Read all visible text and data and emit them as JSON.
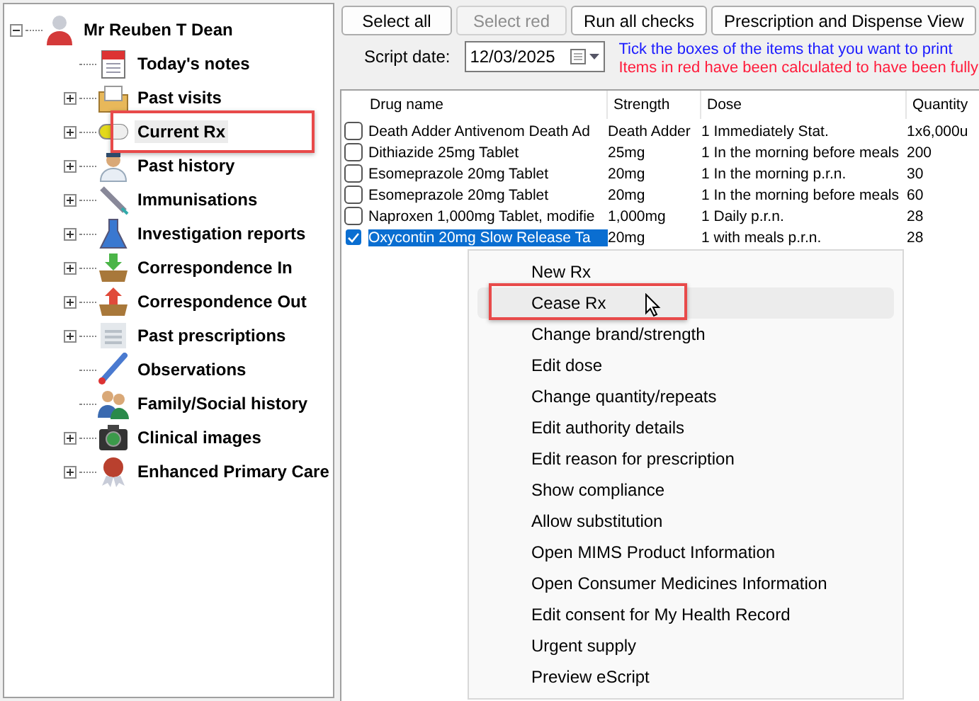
{
  "tree": {
    "label": "Mr Reuben T Dean",
    "expandable": true,
    "expanded": true,
    "children": [
      {
        "label": "Today's notes",
        "expandable": false,
        "selected": false,
        "highlighted": false
      },
      {
        "label": "Past visits",
        "expandable": true,
        "expanded": false,
        "selected": false,
        "highlighted": false
      },
      {
        "label": "Current Rx",
        "expandable": true,
        "expanded": false,
        "selected": true,
        "highlighted": true
      },
      {
        "label": "Past history",
        "expandable": true,
        "expanded": false,
        "selected": false,
        "highlighted": false
      },
      {
        "label": "Immunisations",
        "expandable": true,
        "expanded": false,
        "selected": false,
        "highlighted": false
      },
      {
        "label": "Investigation reports",
        "expandable": true,
        "expanded": false,
        "selected": false,
        "highlighted": false
      },
      {
        "label": "Correspondence In",
        "expandable": true,
        "expanded": false,
        "selected": false,
        "highlighted": false
      },
      {
        "label": "Correspondence Out",
        "expandable": true,
        "expanded": false,
        "selected": false,
        "highlighted": false
      },
      {
        "label": "Past prescriptions",
        "expandable": true,
        "expanded": false,
        "selected": false,
        "highlighted": false
      },
      {
        "label": "Observations",
        "expandable": false,
        "selected": false,
        "highlighted": false
      },
      {
        "label": "Family/Social history",
        "expandable": false,
        "selected": false,
        "highlighted": false
      },
      {
        "label": "Clinical images",
        "expandable": true,
        "expanded": false,
        "selected": false,
        "highlighted": false
      },
      {
        "label": "Enhanced Primary Care",
        "expandable": true,
        "expanded": false,
        "selected": false,
        "highlighted": false
      }
    ]
  },
  "toolbar": [
    {
      "label": "Select all",
      "disabled": false
    },
    {
      "label": "Select red",
      "disabled": true
    },
    {
      "label": "Run all checks",
      "disabled": false
    },
    {
      "label": "Prescription and Dispense View",
      "disabled": false
    }
  ],
  "script_date": {
    "label": "Script date:",
    "value": "12/03/2025"
  },
  "notices": [
    {
      "text": "Tick the boxes of the items that you want to print",
      "color": "#1a1aff"
    },
    {
      "text": "Items in red have been calculated to have been fully",
      "color": "#ff1a3a"
    }
  ],
  "table": {
    "columns": [
      "Drug name",
      "Strength",
      "Dose",
      "Quantity"
    ],
    "rows": [
      {
        "cells": [
          "Death Adder Antivenom Death Ad",
          "Death Adder",
          "1 Immediately Stat.",
          "1x6,000u"
        ],
        "checked": false,
        "selected": false
      },
      {
        "cells": [
          "Dithiazide 25mg Tablet",
          "25mg",
          "1 In the morning before meals",
          "200"
        ],
        "checked": false,
        "selected": false
      },
      {
        "cells": [
          "Esomeprazole 20mg Tablet",
          "20mg",
          "1 In the morning p.r.n.",
          "30"
        ],
        "checked": false,
        "selected": false
      },
      {
        "cells": [
          "Esomeprazole 20mg Tablet",
          "20mg",
          "1 In the morning before meals",
          "60"
        ],
        "checked": false,
        "selected": false
      },
      {
        "cells": [
          "Naproxen 1,000mg Tablet, modifie",
          "1,000mg",
          "1 Daily p.r.n.",
          "28"
        ],
        "checked": false,
        "selected": false
      },
      {
        "cells": [
          "Oxycontin 20mg Slow Release Ta",
          "20mg",
          "1 with meals p.r.n.",
          "28"
        ],
        "checked": true,
        "selected": true
      }
    ]
  },
  "context_menu": [
    {
      "label": "New Rx",
      "hovered": false,
      "highlighted": false
    },
    {
      "label": "Cease Rx",
      "hovered": true,
      "highlighted": true
    },
    {
      "label": "Change brand/strength",
      "hovered": false,
      "highlighted": false
    },
    {
      "label": "Edit dose",
      "hovered": false,
      "highlighted": false
    },
    {
      "label": "Change quantity/repeats",
      "hovered": false,
      "highlighted": false
    },
    {
      "label": "Edit authority details",
      "hovered": false,
      "highlighted": false
    },
    {
      "label": "Edit reason for prescription",
      "hovered": false,
      "highlighted": false
    },
    {
      "label": "Show compliance",
      "hovered": false,
      "highlighted": false
    },
    {
      "label": "Allow substitution",
      "hovered": false,
      "highlighted": false
    },
    {
      "label": "Open MIMS Product Information",
      "hovered": false,
      "highlighted": false
    },
    {
      "label": "Open Consumer Medicines Information",
      "hovered": false,
      "highlighted": false
    },
    {
      "label": "Edit consent for My Health Record",
      "hovered": false,
      "highlighted": false
    },
    {
      "label": "Urgent supply",
      "hovered": false,
      "highlighted": false
    },
    {
      "label": "Preview eScript",
      "hovered": false,
      "highlighted": false
    }
  ]
}
